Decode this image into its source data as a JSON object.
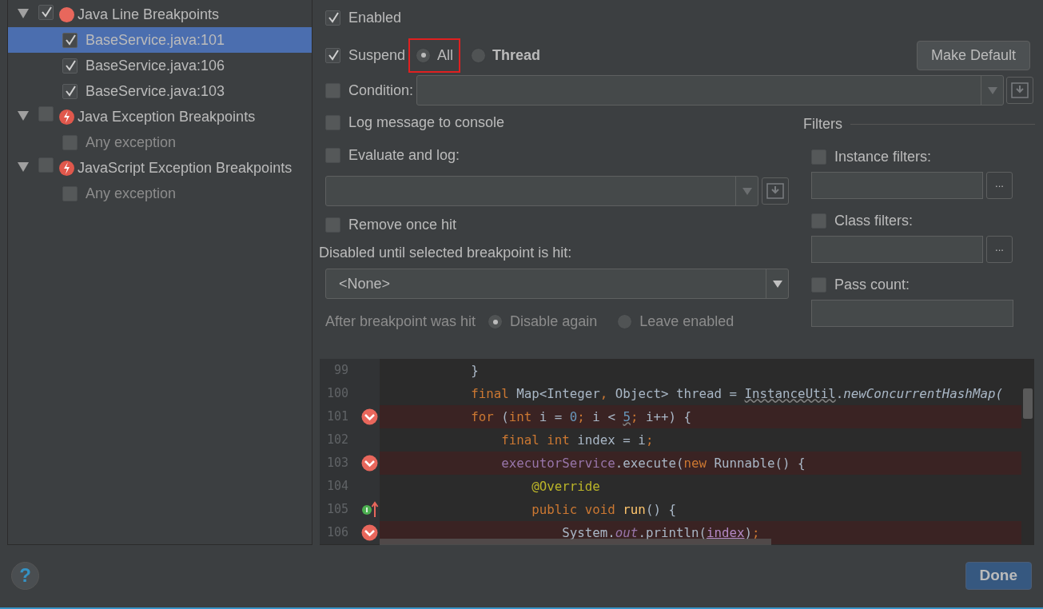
{
  "tree": [
    {
      "label": "Java Line Breakpoints",
      "kind": "line",
      "checked": true,
      "expanded": true,
      "selected": false,
      "children": [
        {
          "label": "BaseService.java:101",
          "checked": true,
          "selected": true,
          "disabled": false
        },
        {
          "label": "BaseService.java:106",
          "checked": true,
          "selected": false,
          "disabled": false
        },
        {
          "label": "BaseService.java:103",
          "checked": true,
          "selected": false,
          "disabled": false
        }
      ]
    },
    {
      "label": "Java Exception Breakpoints",
      "kind": "exception",
      "checked": false,
      "expanded": true,
      "selected": false,
      "children": [
        {
          "label": "Any exception",
          "checked": false,
          "selected": false,
          "disabled": true
        }
      ]
    },
    {
      "label": "JavaScript Exception Breakpoints",
      "kind": "exception",
      "checked": false,
      "expanded": true,
      "selected": false,
      "children": [
        {
          "label": "Any exception",
          "checked": false,
          "selected": false,
          "disabled": true
        }
      ]
    }
  ],
  "enabled": {
    "label": "Enabled",
    "checked": true
  },
  "suspend": {
    "label": "Suspend",
    "checked": true,
    "options": [
      {
        "label": "All",
        "selected": true,
        "highlighted": true,
        "is_default": false
      },
      {
        "label": "Thread",
        "selected": false,
        "highlighted": false,
        "is_default": true
      }
    ]
  },
  "make_default_button": "Make Default",
  "condition": {
    "label": "Condition:",
    "checked": false
  },
  "log_message": {
    "label": "Log message to console",
    "checked": false
  },
  "evaluate_and_log": {
    "label": "Evaluate and log:",
    "checked": false
  },
  "remove_once_hit": {
    "label": "Remove once hit",
    "checked": false
  },
  "disabled_until": {
    "label": "Disabled until selected breakpoint is hit:",
    "value": "<None>"
  },
  "after_hit": {
    "label": "After breakpoint was hit",
    "options": [
      {
        "label": "Disable again",
        "selected": true
      },
      {
        "label": "Leave enabled",
        "selected": false
      }
    ]
  },
  "filters": {
    "title": "Filters",
    "items": [
      {
        "label": "Instance filters:",
        "checked": false,
        "kind": "browse",
        "browse_label": "..."
      },
      {
        "label": "Class filters:",
        "checked": false,
        "kind": "browse",
        "browse_label": "..."
      },
      {
        "label": "Pass count:",
        "checked": false,
        "kind": "plain"
      }
    ]
  },
  "code": [
    {
      "number": "99",
      "breakpoint": false,
      "implements": false,
      "tokens": [
        {
          "text": "            }",
          "kind": "plain"
        }
      ]
    },
    {
      "number": "100",
      "breakpoint": false,
      "implements": false,
      "tokens": [
        {
          "text": "            final",
          "kind": "keyword"
        },
        {
          "text": " Map<Integer",
          "kind": "plain"
        },
        {
          "text": ",",
          "kind": "keyword"
        },
        {
          "text": " Object> thread = ",
          "kind": "plain"
        },
        {
          "text": "InstanceUtil",
          "kind": "warn"
        },
        {
          "text": ".",
          "kind": "plain"
        },
        {
          "text": "newConcurrentHashMap(",
          "kind": "static"
        }
      ]
    },
    {
      "number": "101",
      "breakpoint": true,
      "implements": false,
      "tokens": [
        {
          "text": "            for",
          "kind": "keyword"
        },
        {
          "text": " (",
          "kind": "plain"
        },
        {
          "text": "int",
          "kind": "keyword"
        },
        {
          "text": " i = ",
          "kind": "plain"
        },
        {
          "text": "0",
          "kind": "number"
        },
        {
          "text": ";",
          "kind": "keyword"
        },
        {
          "text": " i < ",
          "kind": "plain"
        },
        {
          "text": "5",
          "kind": "number_warn"
        },
        {
          "text": ";",
          "kind": "keyword"
        },
        {
          "text": " i++) {",
          "kind": "plain"
        }
      ]
    },
    {
      "number": "102",
      "breakpoint": false,
      "implements": false,
      "tokens": [
        {
          "text": "                final int",
          "kind": "keyword"
        },
        {
          "text": " index = i",
          "kind": "plain"
        },
        {
          "text": ";",
          "kind": "keyword"
        }
      ]
    },
    {
      "number": "103",
      "breakpoint": true,
      "implements": false,
      "tokens": [
        {
          "text": "                executorService",
          "kind": "field"
        },
        {
          "text": ".execute(",
          "kind": "plain"
        },
        {
          "text": "new",
          "kind": "keyword"
        },
        {
          "text": " Runnable() {",
          "kind": "plain"
        }
      ]
    },
    {
      "number": "104",
      "breakpoint": false,
      "implements": false,
      "tokens": [
        {
          "text": "                    @Override",
          "kind": "annotation"
        }
      ]
    },
    {
      "number": "105",
      "breakpoint": false,
      "implements": true,
      "tokens": [
        {
          "text": "                    public void",
          "kind": "keyword"
        },
        {
          "text": " run",
          "kind": "method"
        },
        {
          "text": "() {",
          "kind": "plain"
        }
      ]
    },
    {
      "number": "106",
      "breakpoint": true,
      "implements": false,
      "tokens": [
        {
          "text": "                        System.",
          "kind": "plain"
        },
        {
          "text": "out",
          "kind": "static_field"
        },
        {
          "text": ".println(",
          "kind": "plain"
        },
        {
          "text": "index",
          "kind": "param"
        },
        {
          "text": ")",
          "kind": "plain"
        },
        {
          "text": ";",
          "kind": "keyword"
        }
      ]
    }
  ],
  "help_button": "?",
  "done_button": "Done"
}
